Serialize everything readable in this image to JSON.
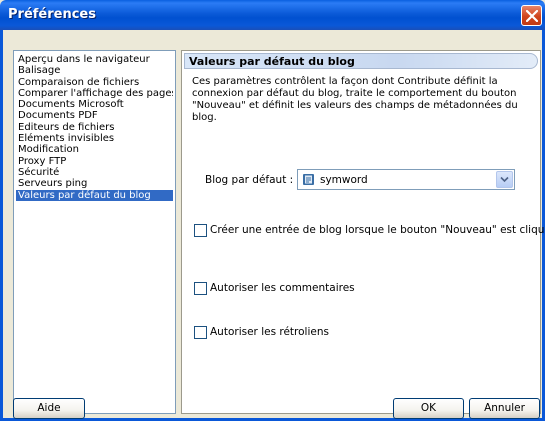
{
  "window": {
    "title": "Préférences"
  },
  "categories": [
    "Aperçu dans le navigateur",
    "Balisage",
    "Comparaison de fichiers",
    "Comparer l'affichage des pages",
    "Documents Microsoft",
    "Documents PDF",
    "Editeurs de fichiers",
    "Eléments invisibles",
    "Modification",
    "Proxy FTP",
    "Sécurité",
    "Serveurs ping",
    "Valeurs par défaut du blog"
  ],
  "selected_category": "Valeurs par défaut du blog",
  "panel": {
    "header": "Valeurs par défaut du blog",
    "description": "Ces paramètres contrôlent la façon dont Contribute définit la connexion par défaut du blog, traite le comportement du bouton \"Nouveau\" et définit les valeurs des champs de métadonnées du blog.",
    "blog_label": "Blog par défaut :",
    "blog_value": "symword",
    "checkbox_create_entry": "Créer une entrée de blog lorsque le bouton \"Nouveau\" est cliqué",
    "checkbox_comments": "Autoriser les commentaires",
    "checkbox_trackbacks": "Autoriser les rétroliens"
  },
  "buttons": {
    "help": "Aide",
    "ok": "OK",
    "cancel": "Annuler"
  },
  "icons": {
    "close": "close-icon",
    "blog": "blog-icon",
    "dropdown": "chevron-down-icon"
  },
  "colors": {
    "titlebar": "#0a58d8",
    "selection": "#316ac5",
    "close": "#d0441c"
  }
}
